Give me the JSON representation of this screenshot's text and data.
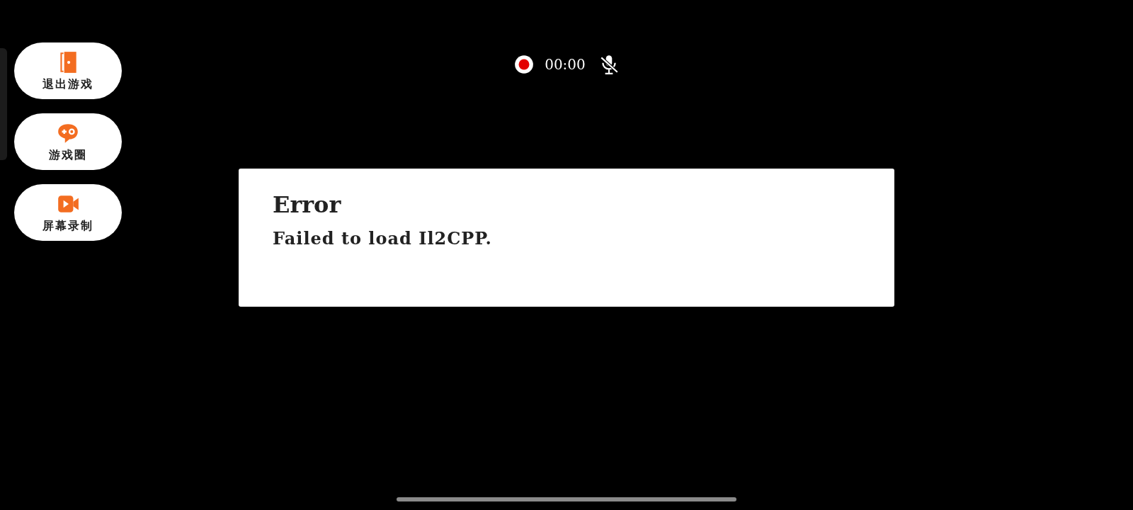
{
  "side_menu": [
    {
      "kind": "exit",
      "label": "退出游戏"
    },
    {
      "kind": "community",
      "label": "游戏圈"
    },
    {
      "kind": "record",
      "label": "屏幕录制"
    }
  ],
  "recording": {
    "time": "00:00",
    "mic_muted": true
  },
  "dialog": {
    "title": "Error",
    "message": "Failed to load Il2CPP."
  }
}
